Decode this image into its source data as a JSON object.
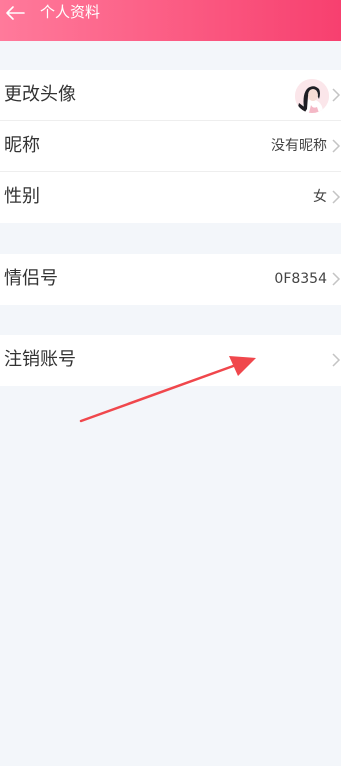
{
  "header": {
    "title": "个人资料",
    "back_icon": "arrow-left-icon"
  },
  "profile": {
    "avatar_label": "更改头像",
    "nickname_label": "昵称",
    "nickname_value": "没有昵称",
    "gender_label": "性别",
    "gender_value": "女"
  },
  "couple": {
    "id_label": "情侣号",
    "id_value": "0F8354"
  },
  "account": {
    "cancel_label": "注销账号"
  },
  "colors": {
    "header_gradient_start": "#ff7a9b",
    "header_gradient_end": "#f7406f",
    "annotation_arrow": "#f0474c"
  }
}
